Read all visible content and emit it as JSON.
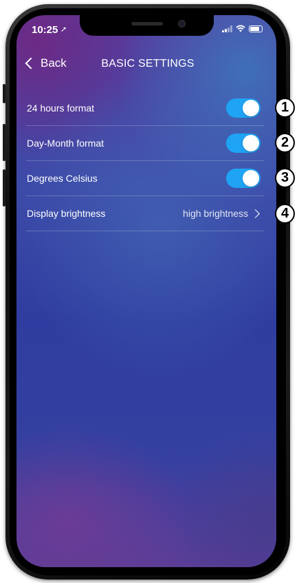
{
  "status_bar": {
    "time": "10:25",
    "location_icon": "➚"
  },
  "nav": {
    "back_label": "Back",
    "title": "BASIC SETTINGS"
  },
  "settings": [
    {
      "label": "24 hours format",
      "type": "toggle",
      "on": true
    },
    {
      "label": "Day-Month format",
      "type": "toggle",
      "on": true
    },
    {
      "label": "Degrees Celsius",
      "type": "toggle",
      "on": true
    },
    {
      "label": "Display brightness",
      "type": "disclosure",
      "value": "high brightness"
    }
  ],
  "callouts": [
    "1",
    "2",
    "3",
    "4"
  ],
  "colors": {
    "toggle_on": "#1fa3f4",
    "text": "#ffffff"
  }
}
